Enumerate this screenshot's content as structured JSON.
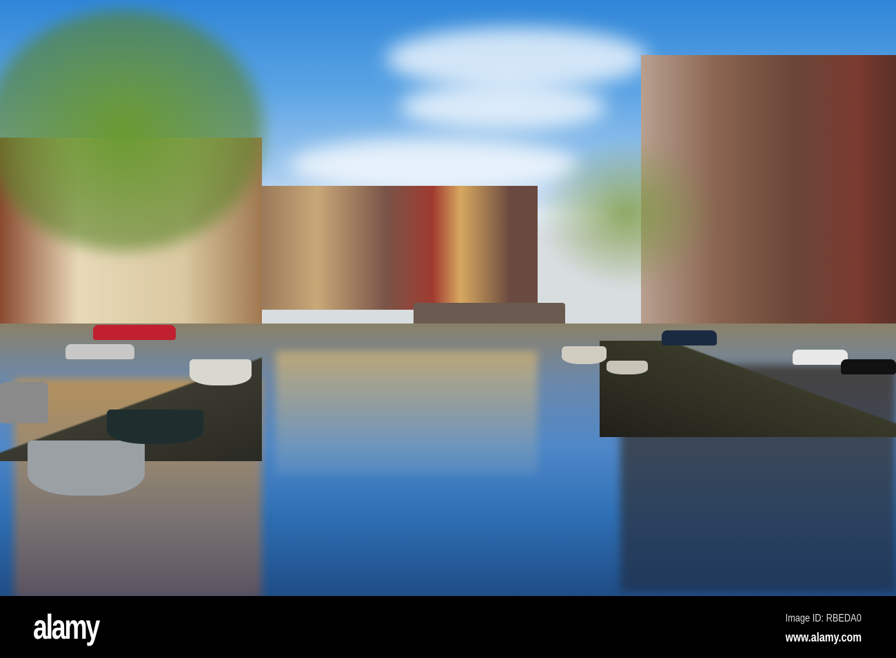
{
  "watermark": {
    "logo": "alamy",
    "image_id": "Image ID: RBEDA0",
    "website": "www.alamy.com"
  },
  "colors": {
    "sky": "#5aa3e4",
    "water": "#2e6fb5",
    "bar": "#000000"
  }
}
